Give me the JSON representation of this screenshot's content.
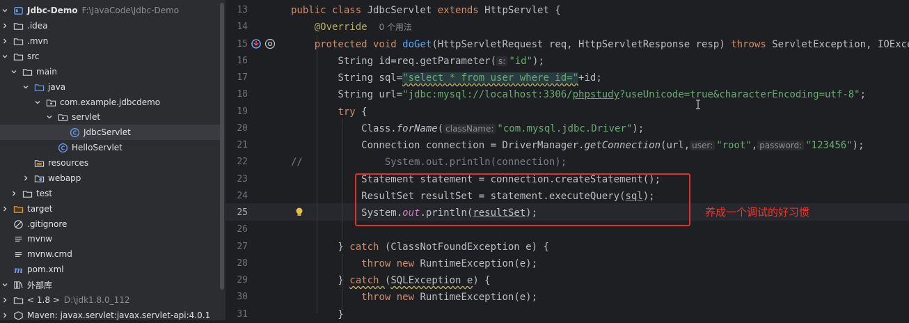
{
  "project_tree": [
    {
      "label": "Jdbc-Demo",
      "path": "F:\\JavaCode\\Jdbc-Demo",
      "depth": 0,
      "icon": "module-icon",
      "chevron": "down",
      "bold": true
    },
    {
      "label": ".idea",
      "depth": 0,
      "icon": "folder-icon",
      "chevron": "right"
    },
    {
      "label": ".mvn",
      "depth": 0,
      "icon": "folder-icon",
      "chevron": "right"
    },
    {
      "label": "src",
      "depth": 0,
      "icon": "folder-icon",
      "chevron": "down"
    },
    {
      "label": "main",
      "depth": 1,
      "icon": "folder-icon",
      "chevron": "down"
    },
    {
      "label": "java",
      "depth": 2,
      "icon": "source-folder-icon",
      "chevron": "down"
    },
    {
      "label": "com.example.jdbcdemo",
      "depth": 3,
      "icon": "package-icon",
      "chevron": "down"
    },
    {
      "label": "servlet",
      "depth": 4,
      "icon": "package-icon",
      "chevron": "down"
    },
    {
      "label": "JdbcServlet",
      "depth": 5,
      "icon": "class-icon",
      "chevron": "none",
      "selected": true
    },
    {
      "label": "HelloServlet",
      "depth": 4,
      "icon": "class-icon",
      "chevron": "none"
    },
    {
      "label": "resources",
      "depth": 2,
      "icon": "resources-folder-icon",
      "chevron": "none"
    },
    {
      "label": "webapp",
      "depth": 2,
      "icon": "web-folder-icon",
      "chevron": "right"
    },
    {
      "label": "test",
      "depth": 1,
      "icon": "folder-icon",
      "chevron": "right"
    },
    {
      "label": "target",
      "depth": 0,
      "icon": "excluded-folder-icon",
      "chevron": "right"
    },
    {
      "label": ".gitignore",
      "depth": 0,
      "icon": "ignore-file-icon",
      "chevron": "none"
    },
    {
      "label": "mvnw",
      "depth": 0,
      "icon": "text-file-icon",
      "chevron": "none"
    },
    {
      "label": "mvnw.cmd",
      "depth": 0,
      "icon": "text-file-icon",
      "chevron": "none"
    },
    {
      "label": "pom.xml",
      "depth": 0,
      "icon": "maven-icon",
      "chevron": "none"
    },
    {
      "label": "外部库",
      "depth": -1,
      "icon": "library-icon",
      "chevron": "down"
    },
    {
      "label": "< 1.8 >",
      "path": "D:\\jdk1.8.0_112",
      "depth": 0,
      "icon": "jdk-icon",
      "chevron": "right"
    },
    {
      "label": "Maven: javax.servlet:javax.servlet-api:4.0.1",
      "depth": 0,
      "icon": "jar-icon",
      "chevron": "right"
    }
  ],
  "editor": {
    "current_line": "25",
    "lines": [
      {
        "num": "13",
        "tokens": [
          [
            "kw",
            "public class "
          ],
          [
            "",
            "JdbcServlet "
          ],
          [
            "kw",
            "extends "
          ],
          [
            "",
            "HttpServlet {"
          ]
        ]
      },
      {
        "num": "14",
        "tokens": [
          [
            "",
            "    "
          ],
          [
            "ann",
            "@Override"
          ],
          [
            "",
            "  "
          ],
          [
            "usage",
            "0 个用法"
          ]
        ]
      },
      {
        "num": "15",
        "tokens": [
          [
            "",
            "    "
          ],
          [
            "kw",
            "protected void "
          ],
          [
            "fn",
            "doGet"
          ],
          [
            "",
            "(HttpServletRequest req, HttpServletResponse resp) "
          ],
          [
            "kw",
            "throws "
          ],
          [
            "",
            "ServletException, IOException {"
          ]
        ]
      },
      {
        "num": "16",
        "tokens": [
          [
            "",
            "        String id=req.getParameter("
          ],
          [
            "hint",
            "s:"
          ],
          [
            "str",
            "\"id\""
          ],
          [
            "",
            ");"
          ]
        ]
      },
      {
        "num": "17",
        "tokens": [
          [
            "",
            "        String sql="
          ],
          [
            "strsql",
            "\"select * from user where id=\""
          ],
          [
            "",
            "+id;"
          ]
        ]
      },
      {
        "num": "18",
        "tokens": [
          [
            "",
            "        String url="
          ],
          [
            "str",
            "\"jdbc:mysql://localhost:3306/"
          ],
          [
            "stru",
            "phpstudy"
          ],
          [
            "str",
            "?useUnicode=true&characterEncoding=utf-8\""
          ],
          [
            "",
            ";"
          ]
        ]
      },
      {
        "num": "19",
        "tokens": [
          [
            "",
            "        "
          ],
          [
            "kw",
            "try "
          ],
          [
            "",
            "{"
          ]
        ]
      },
      {
        "num": "20",
        "tokens": [
          [
            "",
            "            Class."
          ],
          [
            "it",
            "forName"
          ],
          [
            "",
            "("
          ],
          [
            "hint",
            "className:"
          ],
          [
            "str",
            "\"com.mysql.jdbc.Driver\""
          ],
          [
            "",
            ");"
          ]
        ]
      },
      {
        "num": "21",
        "tokens": [
          [
            "",
            "            Connection connection = DriverManager."
          ],
          [
            "it",
            "getConnection"
          ],
          [
            "",
            "(url,"
          ],
          [
            "hint",
            "user:"
          ],
          [
            "str",
            "\"root\""
          ],
          [
            "",
            ","
          ],
          [
            "hint",
            "password:"
          ],
          [
            "str",
            "\"123456\""
          ],
          [
            "",
            ");"
          ]
        ]
      },
      {
        "num": "22",
        "tokens": [
          [
            "cmt",
            "//              System.out.println(connection);"
          ]
        ]
      },
      {
        "num": "23",
        "tokens": [
          [
            "",
            "            Statement statement = connection.createStatement();"
          ]
        ]
      },
      {
        "num": "24",
        "tokens": [
          [
            "",
            "            ResultSet resultSet = statement.executeQuery("
          ],
          [
            "u2",
            "sql"
          ],
          [
            "",
            ");"
          ]
        ]
      },
      {
        "num": "25",
        "tokens": [
          [
            "",
            "            System."
          ],
          [
            "stat",
            "out"
          ],
          [
            "",
            ".println("
          ],
          [
            "u2",
            "resultSet"
          ],
          [
            "",
            ");"
          ]
        ]
      },
      {
        "num": "26",
        "tokens": [
          [
            "",
            ""
          ]
        ]
      },
      {
        "num": "27",
        "tokens": [
          [
            "",
            "        } "
          ],
          [
            "kw",
            "catch "
          ],
          [
            "",
            "(ClassNotFoundException e) {"
          ]
        ]
      },
      {
        "num": "28",
        "tokens": [
          [
            "",
            "            "
          ],
          [
            "kw",
            "throw new "
          ],
          [
            "",
            "RuntimeException(e);"
          ]
        ]
      },
      {
        "num": "29",
        "tokens": [
          [
            "",
            "        } "
          ],
          [
            "kwu",
            "catch "
          ],
          [
            "",
            "("
          ],
          [
            "uu",
            "SQLException e"
          ],
          [
            "",
            ") {"
          ]
        ]
      },
      {
        "num": "30",
        "tokens": [
          [
            "",
            "            "
          ],
          [
            "kw",
            "throw new "
          ],
          [
            "",
            "RuntimeException(e);"
          ]
        ]
      },
      {
        "num": "31",
        "tokens": [
          [
            "",
            "        }"
          ]
        ]
      }
    ]
  },
  "annotation": {
    "text": "养成一个调试的好习惯",
    "color": "#e0302a"
  },
  "colors": {
    "keyword": "#cf8e6d",
    "string": "#6aab73",
    "method": "#56a8f5",
    "annotation": "#b3ae60",
    "comment": "#7a7e85",
    "background": "#1e1f22",
    "sidebar": "#2b2d30"
  }
}
